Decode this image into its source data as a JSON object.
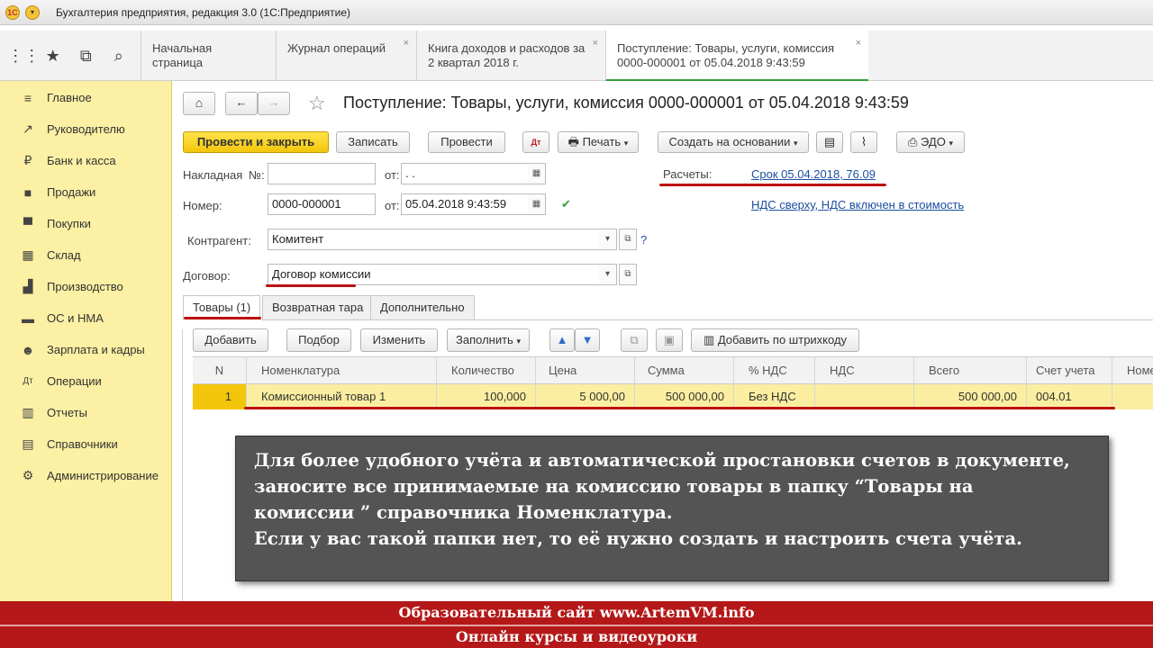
{
  "window": {
    "title": "Бухгалтерия предприятия, редакция 3.0  (1С:Предприятие)"
  },
  "tabs": [
    {
      "label": "Начальная страница"
    },
    {
      "label": "Журнал операций"
    },
    {
      "label": "Книга доходов и расходов за 2 квартал 2018 г."
    },
    {
      "label": "Поступление: Товары, услуги, комиссия 0000-000001 от 05.04.2018 9:43:59"
    }
  ],
  "sidebar": {
    "items": [
      {
        "label": "Главное",
        "icon": "menu-icon"
      },
      {
        "label": "Руководителю",
        "icon": "trend-icon"
      },
      {
        "label": "Банк и касса",
        "icon": "coin-icon"
      },
      {
        "label": "Продажи",
        "icon": "bag-icon"
      },
      {
        "label": "Покупки",
        "icon": "cart-icon"
      },
      {
        "label": "Склад",
        "icon": "warehouse-icon"
      },
      {
        "label": "Производство",
        "icon": "factory-icon"
      },
      {
        "label": "ОС и НМА",
        "icon": "truck-icon"
      },
      {
        "label": "Зарплата и кадры",
        "icon": "people-icon"
      },
      {
        "label": "Операции",
        "icon": "dt-kt-icon"
      },
      {
        "label": "Отчеты",
        "icon": "chart-icon"
      },
      {
        "label": "Справочники",
        "icon": "books-icon"
      },
      {
        "label": "Администрирование",
        "icon": "gear-icon"
      }
    ]
  },
  "doc": {
    "title": "Поступление: Товары, услуги, комиссия 0000-000001 от 05.04.2018 9:43:59",
    "toolbar": {
      "post_close": "Провести и закрыть",
      "save": "Записать",
      "post": "Провести",
      "print": "Печать",
      "create_based": "Создать на основании",
      "edo": "ЭДО"
    },
    "fields": {
      "invoice_label": "Накладная",
      "no_label": "№:",
      "from_label": "от:",
      "invoice_date": " .  .",
      "number_label": "Номер:",
      "number_value": "0000-000001",
      "date_value": "05.04.2018  9:43:59",
      "counterparty_label": "Контрагент:",
      "counterparty_value": "Комитент",
      "contract_label": "Договор:",
      "contract_value": "Договор комиссии",
      "settlements_label": "Расчеты:",
      "settlements_link": "Срок 05.04.2018, 76.09",
      "vat_link": "НДС сверху, НДС включен в стоимость",
      "help": "?"
    },
    "subtabs": [
      "Товары (1)",
      "Возвратная тара",
      "Дополнительно"
    ],
    "table_toolbar": {
      "add": "Добавить",
      "pick": "Подбор",
      "change": "Изменить",
      "fill": "Заполнить",
      "barcode": "Добавить по штрихкоду"
    },
    "table": {
      "columns": [
        "N",
        "Номенклатура",
        "Количество",
        "Цена",
        "Сумма",
        "% НДС",
        "НДС",
        "Всего",
        "Счет учета",
        "Номе"
      ],
      "rows": [
        [
          "1",
          "Комиссионный товар 1",
          "100,000",
          "5 000,00",
          "500 000,00",
          "Без НДС",
          "",
          "500 000,00",
          "004.01",
          ""
        ]
      ]
    }
  },
  "overlay": {
    "line1": "Для более удобного учёта и автоматической простановки счетов в документе,",
    "line2": "заносите все принимаемые на комиссию товары в папку “Товары на",
    "line3": "комиссии ” справочника Номенклатура.",
    "line4": "Если у вас такой папки нет, то её нужно создать и настроить счета учёта."
  },
  "footer": {
    "line1": "Образовательный сайт www.ArtemVM.info",
    "line2": "Онлайн курсы и видеоуроки"
  },
  "colors": {
    "accent": "#2f9f3d",
    "sidebar": "#fbf0a3",
    "primary_button": "#f3c60c",
    "annotation": "#b11111",
    "footer": "#b41818"
  }
}
